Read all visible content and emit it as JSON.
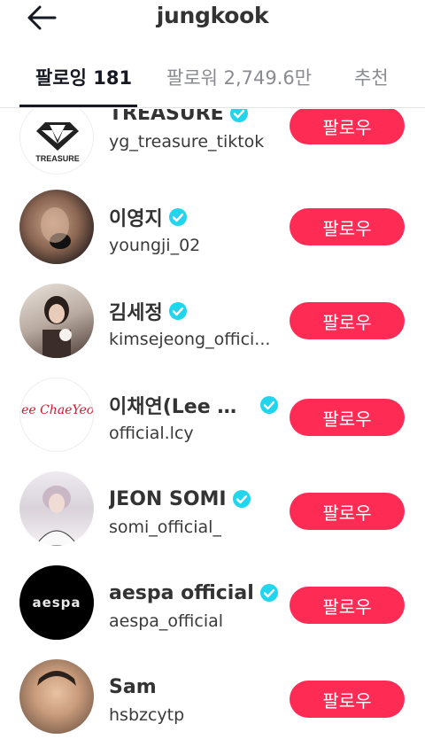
{
  "header": {
    "title": "jungkook"
  },
  "tabs": [
    {
      "label": "팔로잉 181"
    },
    {
      "label": "팔로워 2,749.6만"
    },
    {
      "label": "추천"
    }
  ],
  "users": [
    {
      "name": "TREASURE",
      "handle": "yg_treasure_tiktok",
      "verified": true,
      "button": "팔로우",
      "avatar_text": "TREASURE"
    },
    {
      "name": "이영지",
      "handle": "youngji_02",
      "verified": true,
      "button": "팔로우"
    },
    {
      "name": "김세정",
      "handle": "kimsejeong_offici...",
      "verified": true,
      "button": "팔로우"
    },
    {
      "name": "이채연(Lee C...",
      "handle": "official.lcy",
      "verified": true,
      "button": "팔로우",
      "avatar_text": "Lee ChaeYeon"
    },
    {
      "name": "JEON SOMI",
      "handle": "somi_official_",
      "verified": true,
      "button": "팔로우"
    },
    {
      "name": "aespa official",
      "handle": "aespa_official",
      "verified": true,
      "button": "팔로우",
      "avatar_text": "aespa"
    },
    {
      "name": "Sam",
      "handle": "hsbzcytp",
      "verified": false,
      "button": "팔로우"
    }
  ],
  "colors": {
    "accent": "#fe2c55",
    "verified": "#20d5ec",
    "text": "#161823"
  },
  "icons": {
    "back": "arrow-left-icon",
    "verified": "verified-badge-icon"
  }
}
